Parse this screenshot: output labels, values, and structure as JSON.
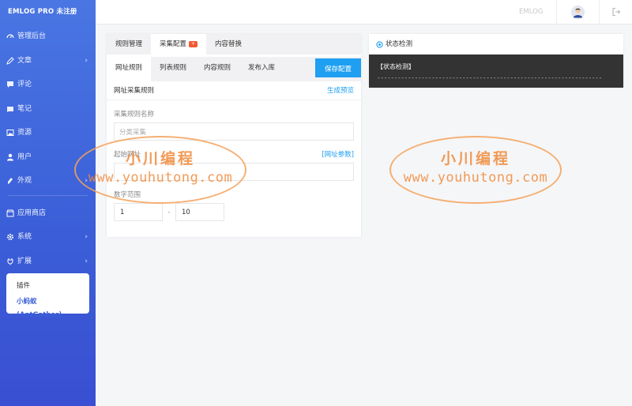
{
  "app": {
    "brand": "EMLOG PRO 未注册"
  },
  "colors": {
    "accent": "#3b5fd8",
    "primary_button": "#1e9ff2",
    "badge": "#f05a30",
    "console_bg": "#333333",
    "watermark": "#f08a3a"
  },
  "sidebar": {
    "items": [
      {
        "label": "管理后台",
        "icon": "dashboard-icon"
      },
      {
        "label": "文章",
        "icon": "pencil-icon",
        "chevron": "›"
      },
      {
        "label": "评论",
        "icon": "comment-icon"
      },
      {
        "label": "笔记",
        "icon": "note-icon"
      },
      {
        "label": "资源",
        "icon": "image-icon"
      },
      {
        "label": "用户",
        "icon": "user-icon"
      },
      {
        "label": "外观",
        "icon": "brush-icon",
        "chevron": "›"
      },
      {
        "label": "应用商店",
        "icon": "store-icon"
      },
      {
        "label": "系统",
        "icon": "gear-icon",
        "chevron": "›"
      },
      {
        "label": "扩展",
        "icon": "plug-icon",
        "chevron": "›"
      }
    ],
    "submenu": [
      "插件",
      "小蚂蚁(AntGather)"
    ]
  },
  "topbar": {
    "link": "EMLOG",
    "avatar": "avatar-icon",
    "logout": "logout-icon"
  },
  "main": {
    "tabs1": [
      {
        "label": "规则管理"
      },
      {
        "label": "采集配置",
        "badge": "+"
      },
      {
        "label": "内容替换"
      }
    ],
    "tabs2": [
      {
        "label": "网址规则"
      },
      {
        "label": "列表规则"
      },
      {
        "label": "内容规则"
      },
      {
        "label": "发布入库"
      }
    ],
    "save_label": "保存配置",
    "section_title": "网址采集规则",
    "section_link": "生成预览",
    "fields": {
      "rule_name_label": "采集规则名称",
      "rule_name_value": "分类采集",
      "start_url_label": "起始网址",
      "start_url_link": "[网址参数]",
      "range_label": "数字范围",
      "range_start": "1",
      "range_sep": "-",
      "range_end": "10"
    }
  },
  "status": {
    "title": "状态检测",
    "console_line1": "【状态检测】",
    "console_line2": "------------------------------------------------------------------"
  },
  "watermarks": [
    {
      "line1": "小川编程",
      "line2": "www.youhutong.com"
    },
    {
      "line1": "小川编程",
      "line2": "www.youhutong.com"
    }
  ]
}
